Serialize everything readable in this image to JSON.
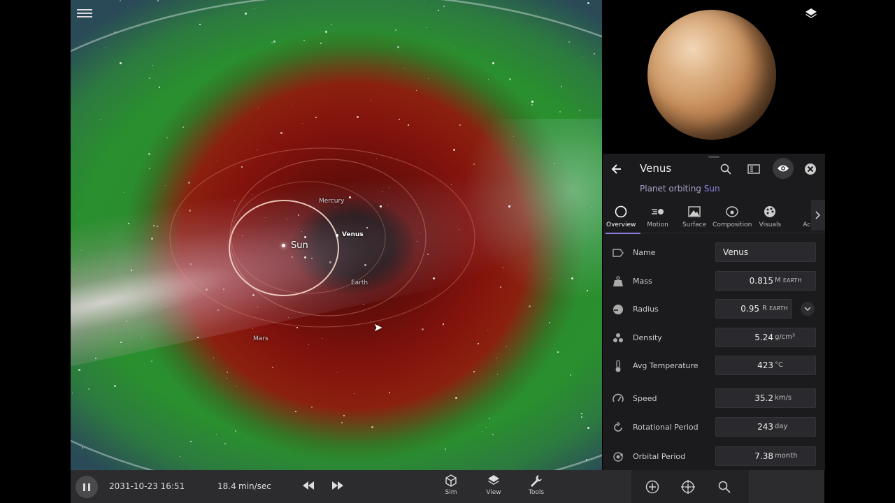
{
  "simulation": {
    "center_label": "Sun",
    "orbit_labels": {
      "mercury": "Mercury",
      "venus": "Venus",
      "earth": "Earth",
      "mars": "Mars"
    }
  },
  "panel": {
    "title": "Venus",
    "subtitle_prefix": "Planet orbiting",
    "subtitle_parent": "Sun",
    "tabs": [
      {
        "label": "Overview",
        "icon": "circle-icon",
        "active": true
      },
      {
        "label": "Motion",
        "icon": "motion-icon",
        "active": false
      },
      {
        "label": "Surface",
        "icon": "surface-icon",
        "active": false
      },
      {
        "label": "Composition",
        "icon": "composition-icon",
        "active": false
      },
      {
        "label": "Visuals",
        "icon": "palette-icon",
        "active": false
      },
      {
        "label": "Ac",
        "icon": "more-icon",
        "active": false
      }
    ],
    "properties": {
      "name": {
        "label": "Name",
        "value": "Venus"
      },
      "mass": {
        "label": "Mass",
        "value": "0.815",
        "unit": "M",
        "unit_sub": "EARTH"
      },
      "radius": {
        "label": "Radius",
        "value": "0.95",
        "unit": "R",
        "unit_sub": "EARTH"
      },
      "density": {
        "label": "Density",
        "value": "5.24",
        "unit": "g/cm³"
      },
      "avg_temperature": {
        "label": "Avg Temperature",
        "value": "423",
        "unit": "°C"
      },
      "speed": {
        "label": "Speed",
        "value": "35.2",
        "unit": "km/s"
      },
      "rotational_period": {
        "label": "Rotational Period",
        "value": "243",
        "unit": "day"
      },
      "orbital_period": {
        "label": "Orbital Period",
        "value": "7.38",
        "unit": "month"
      }
    }
  },
  "bottombar": {
    "datetime": "2031-10-23 16:51",
    "rate_value": "18.4",
    "rate_unit": "min/sec",
    "tools": {
      "sim": "Sim",
      "view": "View",
      "tools": "Tools"
    }
  },
  "colors": {
    "accent": "#8a7fe0",
    "panel_bg": "#1b1b1d",
    "bottombar_bg": "#2c2c2e"
  }
}
